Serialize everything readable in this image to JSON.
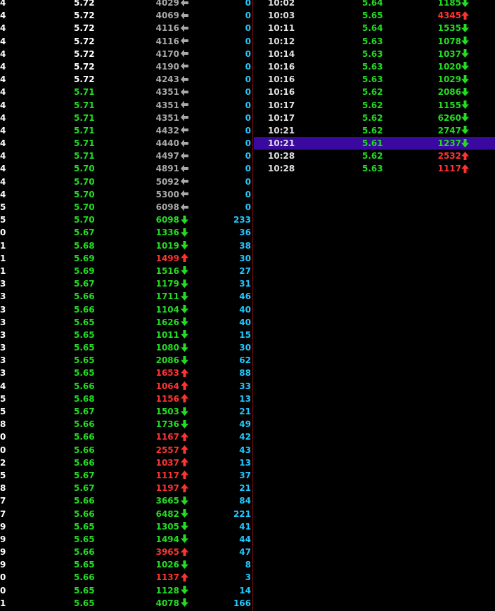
{
  "colors": {
    "up": "#ff3333",
    "down": "#22dd22",
    "neutral": "#a8a8a8",
    "count": "#22c8ff",
    "highlight": "#3a0aa0"
  },
  "left_rows": [
    {
      "min": "4",
      "price": "5.72",
      "price_color": "white",
      "vol": "4029",
      "vol_color": "grey",
      "arrow": "left",
      "count": "0"
    },
    {
      "min": "4",
      "price": "5.72",
      "price_color": "white",
      "vol": "4069",
      "vol_color": "grey",
      "arrow": "left",
      "count": "0"
    },
    {
      "min": "4",
      "price": "5.72",
      "price_color": "white",
      "vol": "4116",
      "vol_color": "grey",
      "arrow": "left",
      "count": "0"
    },
    {
      "min": "4",
      "price": "5.72",
      "price_color": "white",
      "vol": "4116",
      "vol_color": "grey",
      "arrow": "left",
      "count": "0"
    },
    {
      "min": "4",
      "price": "5.72",
      "price_color": "white",
      "vol": "4170",
      "vol_color": "grey",
      "arrow": "left",
      "count": "0"
    },
    {
      "min": "4",
      "price": "5.72",
      "price_color": "white",
      "vol": "4190",
      "vol_color": "grey",
      "arrow": "left",
      "count": "0"
    },
    {
      "min": "4",
      "price": "5.72",
      "price_color": "white",
      "vol": "4243",
      "vol_color": "grey",
      "arrow": "left",
      "count": "0"
    },
    {
      "min": "4",
      "price": "5.71",
      "price_color": "green",
      "vol": "4351",
      "vol_color": "grey",
      "arrow": "left",
      "count": "0"
    },
    {
      "min": "4",
      "price": "5.71",
      "price_color": "green",
      "vol": "4351",
      "vol_color": "grey",
      "arrow": "left",
      "count": "0"
    },
    {
      "min": "4",
      "price": "5.71",
      "price_color": "green",
      "vol": "4351",
      "vol_color": "grey",
      "arrow": "left",
      "count": "0"
    },
    {
      "min": "4",
      "price": "5.71",
      "price_color": "green",
      "vol": "4432",
      "vol_color": "grey",
      "arrow": "left",
      "count": "0"
    },
    {
      "min": "4",
      "price": "5.71",
      "price_color": "green",
      "vol": "4440",
      "vol_color": "grey",
      "arrow": "left",
      "count": "0"
    },
    {
      "min": "4",
      "price": "5.71",
      "price_color": "green",
      "vol": "4497",
      "vol_color": "grey",
      "arrow": "left",
      "count": "0"
    },
    {
      "min": "4",
      "price": "5.70",
      "price_color": "green",
      "vol": "4891",
      "vol_color": "grey",
      "arrow": "left",
      "count": "0"
    },
    {
      "min": "4",
      "price": "5.70",
      "price_color": "green",
      "vol": "5092",
      "vol_color": "grey",
      "arrow": "left",
      "count": "0"
    },
    {
      "min": "4",
      "price": "5.70",
      "price_color": "green",
      "vol": "5300",
      "vol_color": "grey",
      "arrow": "left",
      "count": "0"
    },
    {
      "min": "5",
      "price": "5.70",
      "price_color": "green",
      "vol": "6098",
      "vol_color": "grey",
      "arrow": "left",
      "count": "0"
    },
    {
      "min": "5",
      "price": "5.70",
      "price_color": "green",
      "vol": "6098",
      "vol_color": "green",
      "arrow": "down",
      "count": "233"
    },
    {
      "min": "0",
      "price": "5.67",
      "price_color": "green",
      "vol": "1336",
      "vol_color": "green",
      "arrow": "down",
      "count": "36"
    },
    {
      "min": "1",
      "price": "5.68",
      "price_color": "green",
      "vol": "1019",
      "vol_color": "green",
      "arrow": "down",
      "count": "38"
    },
    {
      "min": "1",
      "price": "5.69",
      "price_color": "green",
      "vol": "1499",
      "vol_color": "red",
      "arrow": "up",
      "count": "30"
    },
    {
      "min": "1",
      "price": "5.69",
      "price_color": "green",
      "vol": "1516",
      "vol_color": "green",
      "arrow": "down",
      "count": "27"
    },
    {
      "min": "3",
      "price": "5.67",
      "price_color": "green",
      "vol": "1179",
      "vol_color": "green",
      "arrow": "down",
      "count": "31"
    },
    {
      "min": "3",
      "price": "5.66",
      "price_color": "green",
      "vol": "1711",
      "vol_color": "green",
      "arrow": "down",
      "count": "46"
    },
    {
      "min": "3",
      "price": "5.66",
      "price_color": "green",
      "vol": "1104",
      "vol_color": "green",
      "arrow": "down",
      "count": "40"
    },
    {
      "min": "3",
      "price": "5.65",
      "price_color": "green",
      "vol": "1626",
      "vol_color": "green",
      "arrow": "down",
      "count": "40"
    },
    {
      "min": "3",
      "price": "5.65",
      "price_color": "green",
      "vol": "1011",
      "vol_color": "green",
      "arrow": "down",
      "count": "15"
    },
    {
      "min": "3",
      "price": "5.65",
      "price_color": "green",
      "vol": "1080",
      "vol_color": "green",
      "arrow": "down",
      "count": "30"
    },
    {
      "min": "3",
      "price": "5.65",
      "price_color": "green",
      "vol": "2086",
      "vol_color": "green",
      "arrow": "down",
      "count": "62"
    },
    {
      "min": "3",
      "price": "5.65",
      "price_color": "green",
      "vol": "1653",
      "vol_color": "red",
      "arrow": "up",
      "count": "88"
    },
    {
      "min": "4",
      "price": "5.66",
      "price_color": "green",
      "vol": "1064",
      "vol_color": "red",
      "arrow": "up",
      "count": "33"
    },
    {
      "min": "5",
      "price": "5.68",
      "price_color": "green",
      "vol": "1156",
      "vol_color": "red",
      "arrow": "up",
      "count": "13"
    },
    {
      "min": "5",
      "price": "5.67",
      "price_color": "green",
      "vol": "1503",
      "vol_color": "green",
      "arrow": "down",
      "count": "21"
    },
    {
      "min": "8",
      "price": "5.66",
      "price_color": "green",
      "vol": "1736",
      "vol_color": "green",
      "arrow": "down",
      "count": "49"
    },
    {
      "min": "0",
      "price": "5.66",
      "price_color": "green",
      "vol": "1167",
      "vol_color": "red",
      "arrow": "up",
      "count": "42"
    },
    {
      "min": "0",
      "price": "5.66",
      "price_color": "green",
      "vol": "2557",
      "vol_color": "red",
      "arrow": "up",
      "count": "43"
    },
    {
      "min": "2",
      "price": "5.66",
      "price_color": "green",
      "vol": "1037",
      "vol_color": "red",
      "arrow": "up",
      "count": "13"
    },
    {
      "min": "5",
      "price": "5.67",
      "price_color": "green",
      "vol": "1117",
      "vol_color": "red",
      "arrow": "up",
      "count": "37"
    },
    {
      "min": "8",
      "price": "5.67",
      "price_color": "green",
      "vol": "1197",
      "vol_color": "red",
      "arrow": "up",
      "count": "21"
    },
    {
      "min": "7",
      "price": "5.66",
      "price_color": "green",
      "vol": "3665",
      "vol_color": "green",
      "arrow": "down",
      "count": "84"
    },
    {
      "min": "7",
      "price": "5.66",
      "price_color": "green",
      "vol": "6482",
      "vol_color": "green",
      "arrow": "down",
      "count": "221"
    },
    {
      "min": "9",
      "price": "5.65",
      "price_color": "green",
      "vol": "1305",
      "vol_color": "green",
      "arrow": "down",
      "count": "41"
    },
    {
      "min": "9",
      "price": "5.65",
      "price_color": "green",
      "vol": "1494",
      "vol_color": "green",
      "arrow": "down",
      "count": "44"
    },
    {
      "min": "9",
      "price": "5.66",
      "price_color": "green",
      "vol": "3965",
      "vol_color": "red",
      "arrow": "up",
      "count": "47"
    },
    {
      "min": "9",
      "price": "5.65",
      "price_color": "green",
      "vol": "1026",
      "vol_color": "green",
      "arrow": "down",
      "count": "8"
    },
    {
      "min": "0",
      "price": "5.66",
      "price_color": "green",
      "vol": "1137",
      "vol_color": "red",
      "arrow": "up",
      "count": "3"
    },
    {
      "min": "0",
      "price": "5.65",
      "price_color": "green",
      "vol": "1128",
      "vol_color": "green",
      "arrow": "down",
      "count": "14"
    },
    {
      "min": "1",
      "price": "5.65",
      "price_color": "green",
      "vol": "4078",
      "vol_color": "green",
      "arrow": "down",
      "count": "166"
    }
  ],
  "right_rows": [
    {
      "time": "10:02",
      "price": "5.64",
      "vol": "1185",
      "vol_color": "green",
      "arrow": "down",
      "highlight": false
    },
    {
      "time": "10:03",
      "price": "5.65",
      "vol": "4345",
      "vol_color": "red",
      "arrow": "up",
      "highlight": false
    },
    {
      "time": "10:11",
      "price": "5.64",
      "vol": "1535",
      "vol_color": "green",
      "arrow": "down",
      "highlight": false
    },
    {
      "time": "10:12",
      "price": "5.63",
      "vol": "1078",
      "vol_color": "green",
      "arrow": "down",
      "highlight": false
    },
    {
      "time": "10:14",
      "price": "5.63",
      "vol": "1037",
      "vol_color": "green",
      "arrow": "down",
      "highlight": false
    },
    {
      "time": "10:16",
      "price": "5.63",
      "vol": "1020",
      "vol_color": "green",
      "arrow": "down",
      "highlight": false
    },
    {
      "time": "10:16",
      "price": "5.63",
      "vol": "1029",
      "vol_color": "green",
      "arrow": "down",
      "highlight": false
    },
    {
      "time": "10:16",
      "price": "5.62",
      "vol": "2086",
      "vol_color": "green",
      "arrow": "down",
      "highlight": false
    },
    {
      "time": "10:17",
      "price": "5.62",
      "vol": "1155",
      "vol_color": "green",
      "arrow": "down",
      "highlight": false
    },
    {
      "time": "10:17",
      "price": "5.62",
      "vol": "6260",
      "vol_color": "green",
      "arrow": "down",
      "highlight": false
    },
    {
      "time": "10:21",
      "price": "5.62",
      "vol": "2747",
      "vol_color": "green",
      "arrow": "down",
      "highlight": false
    },
    {
      "time": "10:21",
      "price": "5.61",
      "vol": "1237",
      "vol_color": "green",
      "arrow": "down",
      "highlight": true
    },
    {
      "time": "10:28",
      "price": "5.62",
      "vol": "2532",
      "vol_color": "red",
      "arrow": "up",
      "highlight": false
    },
    {
      "time": "10:28",
      "price": "5.63",
      "vol": "1117",
      "vol_color": "red",
      "arrow": "up",
      "highlight": false
    }
  ]
}
